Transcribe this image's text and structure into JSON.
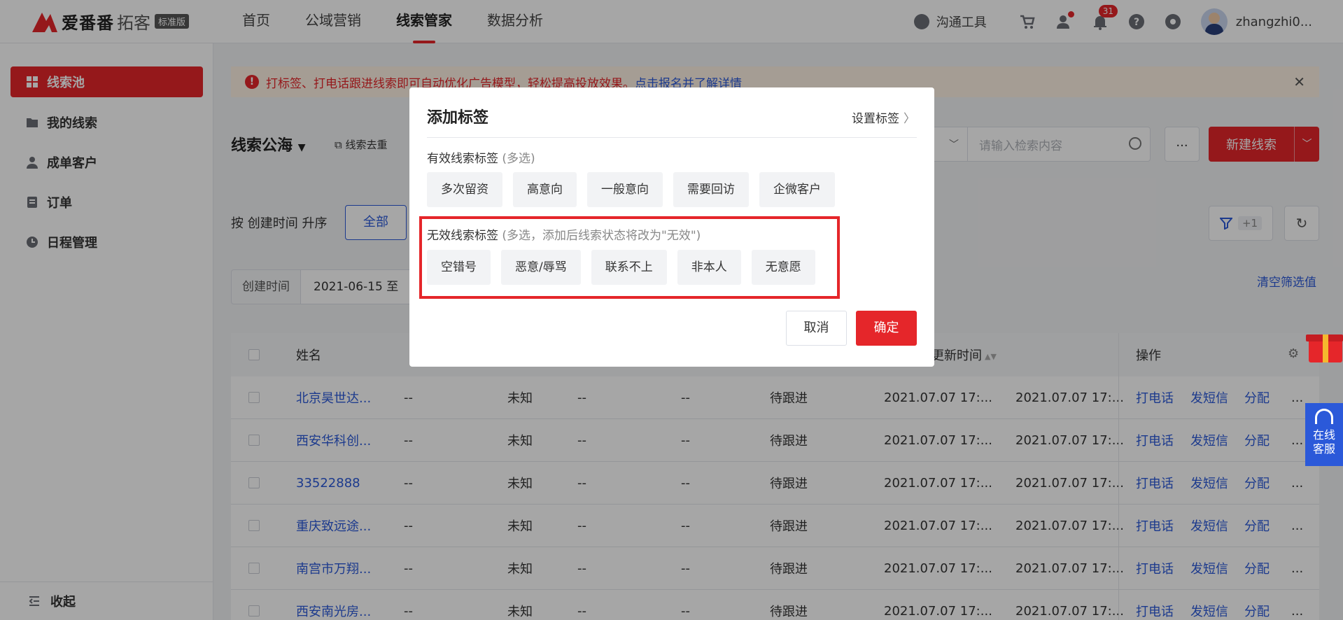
{
  "header": {
    "brand": "爱番番",
    "brand_sub": "拓客",
    "edition": "标准版",
    "nav": [
      "首页",
      "公域营销",
      "线索管家",
      "数据分析"
    ],
    "comm_tool": "沟通工具",
    "notif_count": "31",
    "username": "zhangzhi0..."
  },
  "sidebar": {
    "items": [
      "线索池",
      "我的线索",
      "成单客户",
      "订单",
      "日程管理"
    ],
    "collapse": "收起"
  },
  "notice": {
    "text": "打标签、打电话跟进线索即可自动优化广告模型，轻松提高投放效果。",
    "link": "点击报名并了解详情"
  },
  "toolbar": {
    "title": "线索公海",
    "dedupe": "线索去重",
    "search_placeholder": "请输入检索内容",
    "more": "...",
    "new_button": "新建线索",
    "sort_label": "按 创建时间 升序",
    "all": "全部",
    "filter_count": "+1",
    "date_label": "创建时间",
    "date_value": "2021-06-15  至",
    "clear_filter": "清空筛选值"
  },
  "table": {
    "headers": {
      "name": "姓名",
      "updated": "更新时间",
      "ops": "操作"
    },
    "rows": [
      {
        "name": "北京昊世达...",
        "c1": "--",
        "c2": "未知",
        "c3": "--",
        "c4": "--",
        "status": "待跟进",
        "created": "2021.07.07 17:...",
        "updated": "2021.07.07 17:..."
      },
      {
        "name": "西安华科创...",
        "c1": "--",
        "c2": "未知",
        "c3": "--",
        "c4": "--",
        "status": "待跟进",
        "created": "2021.07.07 17:...",
        "updated": "2021.07.07 17:..."
      },
      {
        "name": "33522888",
        "c1": "--",
        "c2": "未知",
        "c3": "--",
        "c4": "--",
        "status": "待跟进",
        "created": "2021.07.07 17:...",
        "updated": "2021.07.07 17:..."
      },
      {
        "name": "重庆致远途...",
        "c1": "--",
        "c2": "未知",
        "c3": "--",
        "c4": "--",
        "status": "待跟进",
        "created": "2021.07.07 17:...",
        "updated": "2021.07.07 17:..."
      },
      {
        "name": "南宫市万翔...",
        "c1": "--",
        "c2": "未知",
        "c3": "--",
        "c4": "--",
        "status": "待跟进",
        "created": "2021.07.07 17:...",
        "updated": "2021.07.07 17:..."
      },
      {
        "name": "西安南光房...",
        "c1": "--",
        "c2": "未知",
        "c3": "--",
        "c4": "--",
        "status": "待跟进",
        "created": "2021.07.07 17:...",
        "updated": "2021.07.07 17:..."
      }
    ],
    "ops": [
      "打电话",
      "发短信",
      "分配",
      "..."
    ]
  },
  "float": {
    "cs_line1": "在线",
    "cs_line2": "客服"
  },
  "modal": {
    "title": "添加标签",
    "settings": "设置标签",
    "valid_title": "有效线索标签",
    "valid_hint": "(多选)",
    "valid_tags": [
      "多次留资",
      "高意向",
      "一般意向",
      "需要回访",
      "企微客户"
    ],
    "invalid_title": "无效线索标签",
    "invalid_hint": "(多选，添加后线索状态将改为\"无效\")",
    "invalid_tags": [
      "空错号",
      "恶意/辱骂",
      "联系不上",
      "非本人",
      "无意愿"
    ],
    "cancel": "取消",
    "confirm": "确定"
  },
  "colors": {
    "brand_red": "#e5262a",
    "link_blue": "#2b59d9"
  }
}
